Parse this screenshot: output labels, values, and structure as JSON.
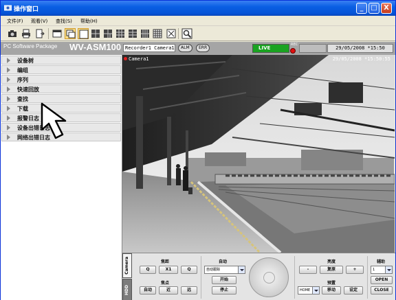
{
  "window": {
    "title": "操作窗口",
    "buttons": [
      "_",
      "□",
      "X"
    ]
  },
  "menu": [
    "文件(F)",
    "观看(V)",
    "查找(S)",
    "帮助(H)"
  ],
  "header": {
    "brand_prefix": "PC Software Package",
    "brand_name": "WV-ASM100",
    "recorder": "Recorder1 Camera1",
    "alm_label": "ALM",
    "err_label": "ERR",
    "live_label": "LIVE",
    "rec_label": "REC",
    "datetime": "29/05/2008 *15:50"
  },
  "tree": {
    "items": [
      "设备树",
      "编组",
      "序列",
      "快速回放",
      "查找",
      "下载",
      "报警日志",
      "设备出错日志",
      "网络出错日志"
    ]
  },
  "camera": {
    "label": "Camera1",
    "timestamp": "29/05/2008 *15:50:55"
  },
  "panel": {
    "tabs": [
      "Camera",
      "HDD"
    ],
    "zoom": {
      "title": "焦距",
      "zoom_out": "Q",
      "x1": "X1",
      "zoom_in": "Q"
    },
    "focus": {
      "title": "焦点",
      "auto": "自动",
      "near": "近",
      "far": "远"
    },
    "auto": {
      "title": "自动",
      "select_value": "自动跟踪",
      "start": "开始",
      "stop": "停止"
    },
    "brightness": {
      "title": "亮度",
      "minus": "-",
      "reset": "复原",
      "plus": "+"
    },
    "preset": {
      "title": "预置",
      "select_value": "HOME",
      "move": "移动",
      "set": "设定"
    },
    "aux": {
      "title": "辅助",
      "select_value": "1",
      "open": "OPEN",
      "close": "CLOSE"
    }
  },
  "colors": {
    "titlebar": "#0a5fe3",
    "live": "#1aa321",
    "rec": "#e01010",
    "header_band": "#a5a5a5"
  }
}
